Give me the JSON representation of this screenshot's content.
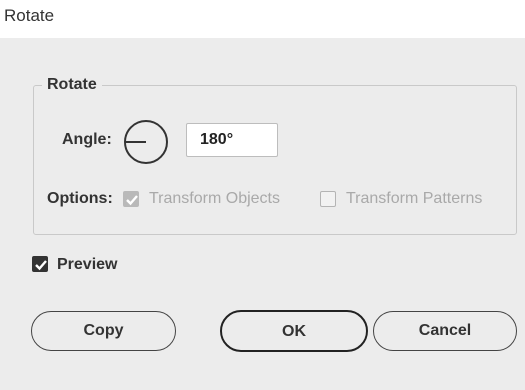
{
  "window": {
    "title": "Rotate"
  },
  "rotate_group": {
    "legend": "Rotate",
    "angle_label": "Angle:",
    "angle_value": "180°",
    "options_label": "Options:",
    "transform_objects": {
      "label": "Transform Objects",
      "checked": true,
      "enabled": false
    },
    "transform_patterns": {
      "label": "Transform Patterns",
      "checked": false,
      "enabled": false
    }
  },
  "preview": {
    "label": "Preview",
    "checked": true
  },
  "buttons": {
    "copy": "Copy",
    "ok": "OK",
    "cancel": "Cancel"
  },
  "colors": {
    "dialog_background": "#ececec",
    "titlebar_background": "#ffffff",
    "disabled_text": "#a9a9a9",
    "checkbox_checked": "#333333"
  },
  "icons": {
    "angle_dial": "angle-dial-icon",
    "checkmark": "checkmark-icon"
  }
}
